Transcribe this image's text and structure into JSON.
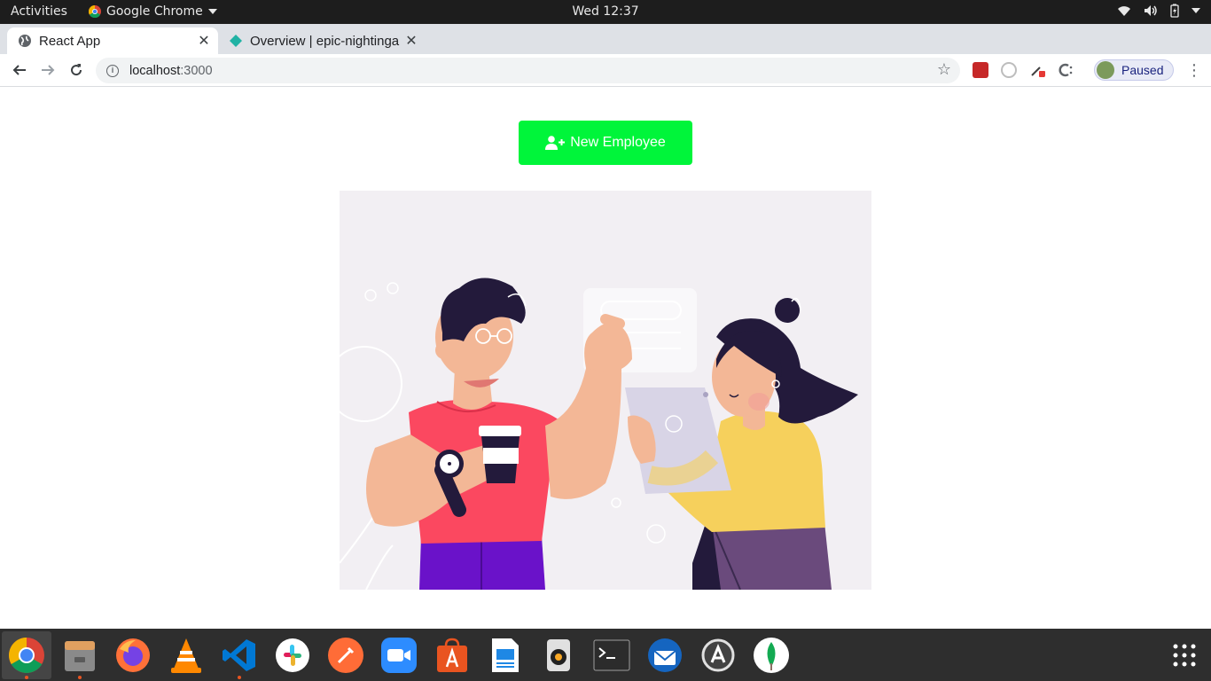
{
  "topbar": {
    "activities": "Activities",
    "app_name": "Google Chrome",
    "clock": "Wed 12:37"
  },
  "tabs": [
    {
      "label": "React App",
      "icon": "globe-icon",
      "active": true
    },
    {
      "label": "Overview | epic-nightinga",
      "icon": "netlify-diamond-icon",
      "active": false
    }
  ],
  "toolbar": {
    "url_host": "localhost",
    "url_port": ":3000",
    "profile_status": "Paused"
  },
  "page": {
    "new_employee_label": "New Employee",
    "button_color": "#00f53a",
    "illustration_background": "#f2eff3"
  },
  "dock": {
    "items": [
      {
        "name": "chrome-icon",
        "running": true
      },
      {
        "name": "files-icon",
        "running": true
      },
      {
        "name": "firefox-icon",
        "running": false
      },
      {
        "name": "vlc-icon",
        "running": false
      },
      {
        "name": "vscode-icon",
        "running": true
      },
      {
        "name": "slack-icon",
        "running": false
      },
      {
        "name": "postman-icon",
        "running": false
      },
      {
        "name": "zoom-icon",
        "running": false
      },
      {
        "name": "software-center-icon",
        "running": false
      },
      {
        "name": "writer-icon",
        "running": false
      },
      {
        "name": "speaker-icon",
        "running": false
      },
      {
        "name": "terminal-icon",
        "running": false
      },
      {
        "name": "thunderbird-icon",
        "running": false
      },
      {
        "name": "updater-icon",
        "running": false
      },
      {
        "name": "mongodb-icon",
        "running": false
      }
    ],
    "show_apps_icon": "grid-icon"
  }
}
